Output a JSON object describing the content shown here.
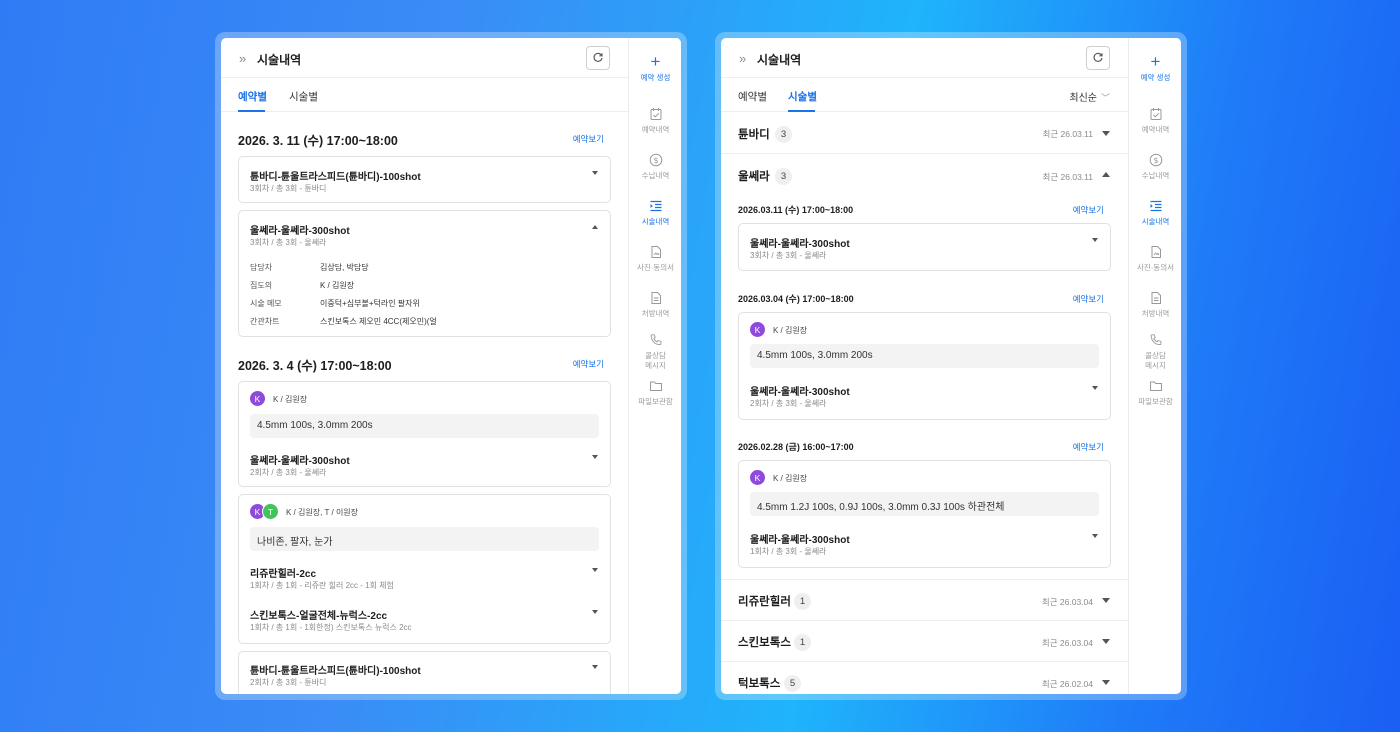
{
  "panel": {
    "title": "시술내역"
  },
  "rail": [
    {
      "label": "예약 생성",
      "icon": "plus-icon",
      "active": true
    },
    {
      "label": "예약내역",
      "icon": "calendar-check-icon"
    },
    {
      "label": "수납내역",
      "icon": "dollar-circle-icon"
    },
    {
      "label": "시술내역",
      "icon": "list-indent-icon",
      "active": true
    },
    {
      "label": "사진·동의서",
      "icon": "document-image-icon"
    },
    {
      "label": "처방내역",
      "icon": "document-lines-icon"
    },
    {
      "label": "콜상담\n메시지",
      "icon": "phone-icon"
    },
    {
      "label": "파일보관함",
      "icon": "folder-icon"
    }
  ],
  "left": {
    "tabs": [
      "예약별",
      "시술별"
    ],
    "active_tab": "예약별",
    "view_link": "예약보기",
    "groups": [
      {
        "date": "2026. 3. 11 (수) 17:00~18:00",
        "cards": [
          {
            "title": "튠바디-튠울트라스피드(튠바디)-100shot",
            "sub": "3회차 / 총 3회 - 튠바디"
          },
          {
            "title": "울쎄라-울쎄라-300shot",
            "sub": "3회차 / 총 3회 - 울쎄라",
            "details": [
              {
                "label": "담당자",
                "value": "김상담, 박담당"
              },
              {
                "label": "집도의",
                "value": "K / 김원장"
              },
              {
                "label": "시술 메모",
                "value": "이중턱+심부볼+턱라인 팔자위"
              },
              {
                "label": "간관차트",
                "value": "스킨보톡스 제오민  4CC(제오민)(얼"
              }
            ]
          }
        ]
      },
      {
        "date": "2026. 3. 4 (수) 17:00~18:00",
        "cards": [
          {
            "avatars": [
              "K"
            ],
            "staff": "K / 김원장",
            "memo": "4.5mm 100s, 3.0mm 200s",
            "items": [
              {
                "title": "울쎄라-울쎄라-300shot",
                "sub": "2회차 / 총 3회 - 울쎄라"
              }
            ]
          },
          {
            "avatars": [
              "K",
              "T"
            ],
            "staff": "K / 김원장, T / 이원장",
            "memo": "나비존, 팔자, 눈가",
            "items": [
              {
                "title": "리쥬란힐러-2cc",
                "sub": "1회차 / 총 1회 - 리쥬란 힐러 2cc - 1회 체험"
              },
              {
                "title": "스킨보톡스-얼굴전체-뉴럭스-2cc",
                "sub": "1회차 / 총 1회 - 1회한정) 스킨보톡스 뉴럭스 2cc"
              }
            ]
          },
          {
            "title": "튠바디-튠울트라스피드(튠바디)-100shot",
            "sub": "2회차 / 총 3회 - 튠바디"
          }
        ]
      }
    ]
  },
  "right": {
    "tabs": [
      "예약별",
      "시술별"
    ],
    "active_tab": "시술별",
    "sort": "최신순",
    "view_link": "예약보기",
    "groups": [
      {
        "name": "튠바디",
        "count": "3",
        "recent": "최근 26.03.11"
      },
      {
        "name": "울쎄라",
        "count": "3",
        "recent": "최근 26.03.11",
        "sessions": [
          {
            "date": "2026.03.11 (수) 17:00~18:00",
            "items": [
              {
                "title": "울쎄라-울쎄라-300shot",
                "sub": "3회차 / 총 3회 - 울쎄라"
              }
            ]
          },
          {
            "date": "2026.03.04 (수) 17:00~18:00",
            "avatar": "K",
            "staff": "K / 김원장",
            "memo": "4.5mm 100s, 3.0mm 200s",
            "items": [
              {
                "title": "울쎄라-울쎄라-300shot",
                "sub": "2회차 / 총 3회 - 울쎄라"
              }
            ]
          },
          {
            "date": "2026.02.28 (금) 16:00~17:00",
            "avatar": "K",
            "staff": "K / 김원장",
            "memo": "4.5mm 1.2J 100s, 0.9J 100s, 3.0mm 0.3J 100s 하관전체",
            "items": [
              {
                "title": "울쎄라-울쎄라-300shot",
                "sub": "1회차 / 총 3회 - 울쎄라"
              }
            ]
          }
        ]
      },
      {
        "name": "리쥬란힐러",
        "count": "1",
        "recent": "최근 26.03.04"
      },
      {
        "name": "스킨보톡스",
        "count": "1",
        "recent": "최근 26.03.04"
      },
      {
        "name": "턱보톡스",
        "count": "5",
        "recent": "최근 26.02.04"
      }
    ]
  },
  "colors": {
    "accent": "#1a73e8",
    "avatar_k": "#8e4bdb",
    "avatar_t": "#41c45a"
  }
}
